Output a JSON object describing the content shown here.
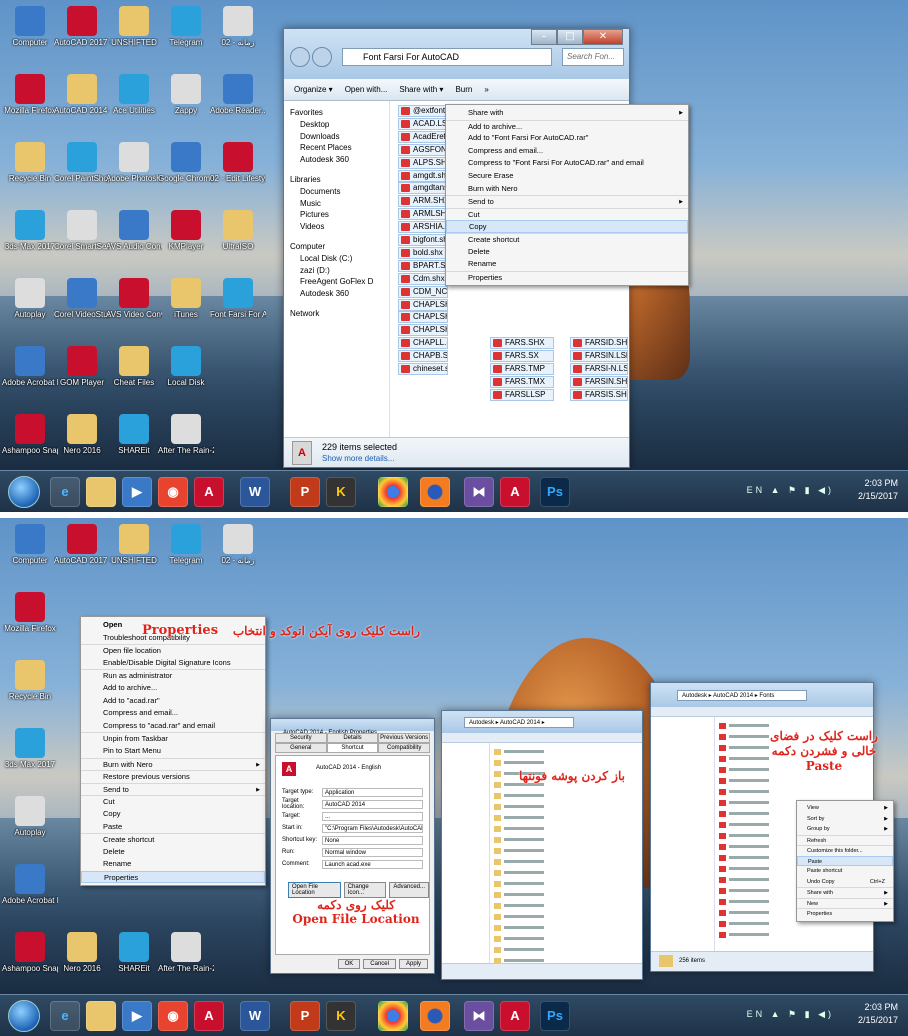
{
  "desktop_icons_top": [
    [
      "Computer",
      "AutoCAD 2017 - E...",
      "UNSHIFTED",
      "Telegram",
      "02 - زمانه"
    ],
    [
      "Mozilla Firefox",
      "AutoCAD 2014 - E...",
      "Ace Utilities",
      "Zappy",
      "Adobe Reader..."
    ],
    [
      "Recycle Bin",
      "Corel PaintShop...",
      "Adobe Photosho...",
      "Google Chrome",
      "02 - Edit Lifestyle"
    ],
    [
      "3ds Max 2017",
      "Corel SmartSe...",
      "AVS Audio Converter",
      "KMPlayer",
      "UltraISO"
    ],
    [
      "Autoplay",
      "Corel VideoStud...",
      "AVS Video Converter",
      "iTunes",
      "Font Farsi For AutoCAD"
    ],
    [
      "Adobe Acrobat DC",
      "GOM Player",
      "Cheat Files",
      "Local Disk"
    ],
    [
      "Ashampoo Snap 9",
      "Nero 2016",
      "SHAREit",
      "After The Rain-20161..."
    ]
  ],
  "explorer1": {
    "address": "Font Farsi For AutoCAD",
    "search_placeholder": "Search Fon...",
    "toolbar": [
      "Organize ▾",
      "Open with...",
      "Share with ▾",
      "Burn",
      "»"
    ],
    "nav": [
      "Favorites",
      "Desktop",
      "Downloads",
      "Recent Places",
      "Autodesk 360",
      "Libraries",
      "Documents",
      "Music",
      "Pictures",
      "Videos",
      "Computer",
      "Local Disk (C:)",
      "zazi (D:)",
      "FreeAgent GoFlex D",
      "Autodesk 360",
      "Network"
    ],
    "files_col1": [
      "@extfont2.shx",
      "ACAD.LSP",
      "AcadEref",
      "AGSFON...",
      "ALPS.SHX",
      "amgdt.shx",
      "amgdtans",
      "ARM.SHX",
      "ARMLSHX",
      "ARSHIA.SHX",
      "bigfont.shx",
      "bold.shx",
      "BPART.SHX",
      "Cdm.shx",
      "CDM_NC",
      "CHAPLSHX",
      "CHAPLSHX",
      "CHAPLSHX",
      "CHAPLL.SHX",
      "CHAPB.SHX",
      "chineset.shx"
    ],
    "files_col2": [
      "FARS.SHX",
      "FARS.SX",
      "FARS.TMP",
      "FARS.TMX",
      "FARSLLSP"
    ],
    "files_col3": [
      "FARSID.SHX",
      "FARSIN.LSP",
      "FARSI-N.LSP",
      "FARSIN.SHX",
      "FARSIS.SHP"
    ],
    "status_count": "229 items selected",
    "status_more": "Show more details..."
  },
  "ctx1": [
    "Share with",
    "Add to archive...",
    "Add to \"Font Farsi For AutoCAD.rar\"",
    "Compress and email...",
    "Compress to \"Font Farsi For AutoCAD.rar\" and email",
    "Secure Erase",
    "Burn with Nero",
    "Send to",
    "Cut",
    "Copy",
    "Create shortcut",
    "Delete",
    "Rename",
    "Properties"
  ],
  "ctx2": [
    "Open",
    "Troubleshoot compatibility",
    "Open file location",
    "Enable/Disable Digital Signature Icons",
    "Run as administrator",
    "Add to archive...",
    "Add to \"acad.rar\"",
    "Compress and email...",
    "Compress to \"acad.rar\" and email",
    "Unpin from Taskbar",
    "Pin to Start Menu",
    "Burn with Nero",
    "Restore previous versions",
    "Send to",
    "Cut",
    "Copy",
    "Paste",
    "Create shortcut",
    "Delete",
    "Rename",
    "Properties"
  ],
  "props": {
    "title": "AutoCAD 2014 - English Properties",
    "tabs": [
      "Security",
      "Details",
      "Previous Versions",
      "General",
      "Shortcut",
      "Compatibility"
    ],
    "name": "AutoCAD 2014 - English",
    "rows": [
      [
        "Target type:",
        "Application"
      ],
      [
        "Target location:",
        "AutoCAD 2014"
      ],
      [
        "Target:",
        "..."
      ],
      [
        "Start in:",
        "\"C:\\Program Files\\Autodesk\\AutoCAD 2014\\Use"
      ],
      [
        "Shortcut key:",
        "None"
      ],
      [
        "Run:",
        "Normal window"
      ],
      [
        "Comment:",
        "Launch acad.exe"
      ]
    ],
    "buttons": [
      "Open File Location",
      "Change Icon...",
      "Advanced..."
    ],
    "ok": "OK",
    "cancel": "Cancel",
    "apply": "Apply"
  },
  "explorer2": {
    "address": "Autodesk ▸ AutoCAD 2014 ▸"
  },
  "explorer3": {
    "address": "Autodesk ▸ AutoCAD 2014 ▸ Fonts",
    "status": "256 items"
  },
  "ctx3": [
    "View",
    "Sort by",
    "Group by",
    "Refresh",
    "Customize this folder...",
    "Paste",
    "Paste shortcut",
    "Undo Copy",
    "Share with",
    "New",
    "Properties"
  ],
  "ctx3_shortcut": "Ctrl+Z",
  "notes": {
    "n1": "راست کلیک روی آیکن اتوکد و انتخاب",
    "n1_en": "Properties",
    "n2a": "کلیک روی دکمه",
    "n2b": "Open File Location",
    "n3": "باز کردن پوشه فونتها",
    "n4a": "راست کلیک در فضای",
    "n4b": "خالی و فشردن دکمه",
    "n4c": "Paste"
  },
  "tray": {
    "lang": "EN",
    "time": "2:03 PM",
    "date": "2/15/2017"
  }
}
